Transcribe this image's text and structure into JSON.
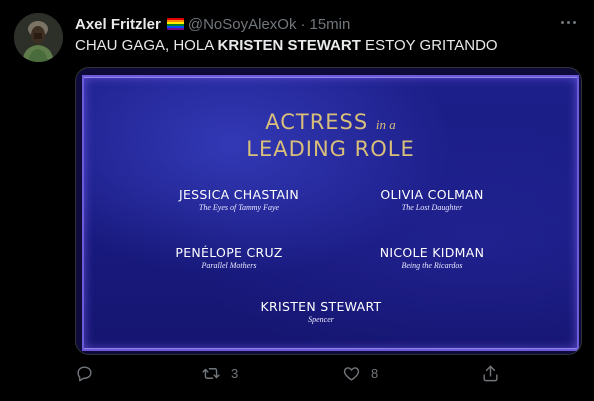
{
  "tweet": {
    "display_name": "Axel Fritzler",
    "flag_icon": "rainbow-flag-icon",
    "handle": "@NoSoyAlexOk",
    "separator": "·",
    "time": "15min",
    "text_prefix": "CHAU GAGA, HOLA ",
    "text_bold": "KRISTEN STEWART",
    "text_suffix": " ESTOY GRITANDO",
    "more_icon": "more-options-icon"
  },
  "media": {
    "category_line1": "ACTRESS",
    "category_small": "in a",
    "category_line2": "LEADING ROLE",
    "nominees": [
      {
        "name": "JESSICA CHASTAIN",
        "film": "The Eyes of Tammy Faye"
      },
      {
        "name": "OLIVIA COLMAN",
        "film": "The Lost Daughter"
      },
      {
        "name": "PENÉLOPE CRUZ",
        "film": "Parallel Mothers"
      },
      {
        "name": "NICOLE KIDMAN",
        "film": "Being the Ricardos"
      },
      {
        "name": "KRISTEN STEWART",
        "film": "Spencer"
      }
    ]
  },
  "actions": {
    "reply_icon": "reply-icon",
    "retweet_icon": "retweet-icon",
    "retweet_count": "3",
    "like_icon": "heart-icon",
    "like_count": "8",
    "share_icon": "share-icon"
  },
  "colors": {
    "background": "#000000",
    "text_primary": "#e7e9ea",
    "text_secondary": "#71767b",
    "gold": "#d9bf7a",
    "screen_blue": "#1d1f8a"
  }
}
